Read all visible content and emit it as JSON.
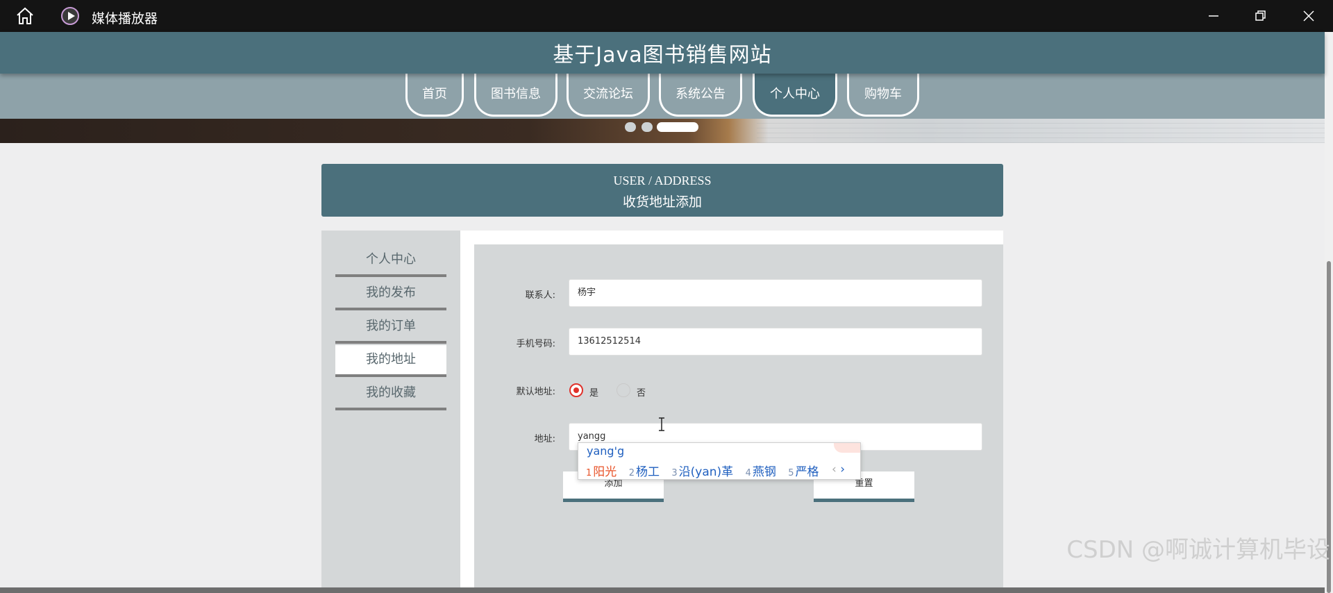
{
  "window": {
    "app_title": "媒体播放器",
    "icons": [
      "home-icon",
      "media-player-icon",
      "minimize-icon",
      "maximize-icon",
      "close-icon"
    ]
  },
  "site": {
    "title": "基于Java图书销售网站"
  },
  "nav": {
    "items": [
      {
        "label": "首页"
      },
      {
        "label": "图书信息"
      },
      {
        "label": "交流论坛"
      },
      {
        "label": "系统公告"
      },
      {
        "label": "个人中心",
        "active": true
      },
      {
        "label": "购物车"
      }
    ]
  },
  "carousel": {
    "slide_count": 3,
    "active_slide": 3
  },
  "section": {
    "title_en": "USER / ADDRESS",
    "title_cn": "收货地址添加"
  },
  "sidebar": {
    "items": [
      {
        "label": "个人中心"
      },
      {
        "label": "我的发布"
      },
      {
        "label": "我的订单"
      },
      {
        "label": "我的地址",
        "active": true
      },
      {
        "label": "我的收藏"
      }
    ]
  },
  "form": {
    "contact": {
      "label": "联系人:",
      "value": "杨宇"
    },
    "phone": {
      "label": "手机号码:",
      "value": "13612512514"
    },
    "default_address": {
      "label": "默认地址:",
      "yes": "是",
      "no": "否",
      "selected": "是"
    },
    "address": {
      "label": "地址:",
      "value": "yangg"
    },
    "add_button": "添加",
    "reset_button": "重置"
  },
  "ime": {
    "composition": "yang'g",
    "candidates": [
      {
        "num": "1",
        "text": "阳光"
      },
      {
        "num": "2",
        "text": "杨工"
      },
      {
        "num": "3",
        "text": "沿(yan)革"
      },
      {
        "num": "4",
        "text": "燕钢"
      },
      {
        "num": "5",
        "text": "严格"
      }
    ],
    "prev": "‹",
    "next": "›"
  },
  "watermark": "CSDN @啊诚计算机毕设",
  "colors": {
    "primary": "#4b707c",
    "nav_band": "#8ea2a9",
    "panel": "#d4d7d8",
    "radio_checked": "#e0312a"
  }
}
